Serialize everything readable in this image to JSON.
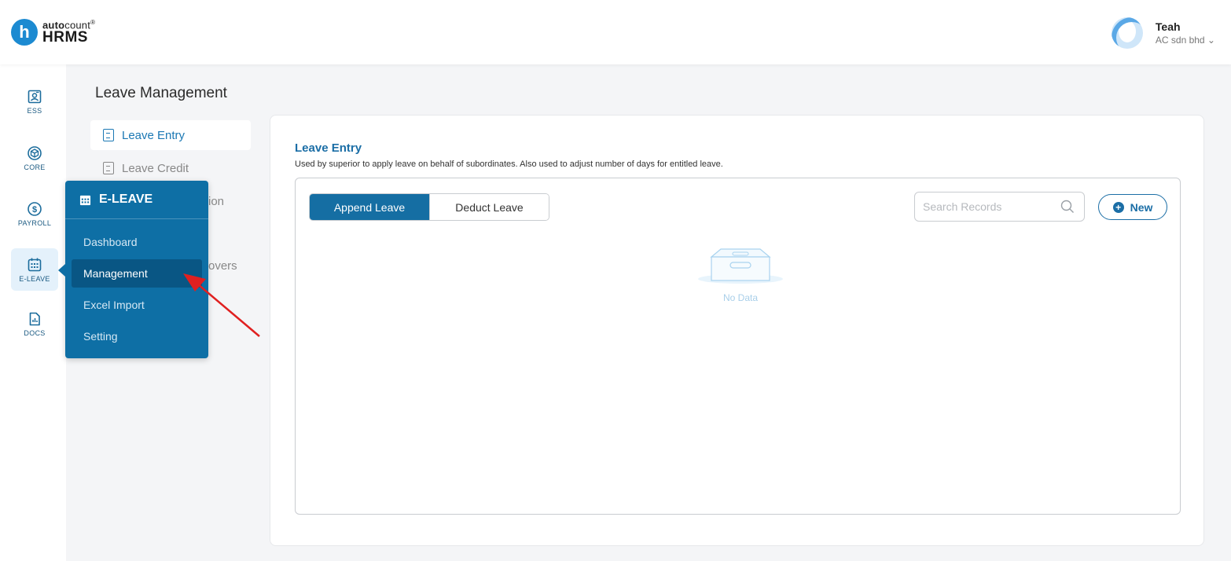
{
  "header": {
    "logo_letter": "h",
    "logo_brand_bold": "auto",
    "logo_brand_light": "count",
    "logo_mark": "®",
    "logo_product": "HRMS",
    "user_name": "Teah",
    "company": "AC sdn bhd ⌄"
  },
  "rail": {
    "items": [
      {
        "label": "ESS",
        "icon": "ess-icon"
      },
      {
        "label": "CORE",
        "icon": "cube-icon"
      },
      {
        "label": "PAYROLL",
        "icon": "dollar-icon"
      },
      {
        "label": "E-LEAVE",
        "icon": "calendar-icon"
      },
      {
        "label": "DOCS",
        "icon": "document-chart-icon"
      }
    ],
    "active": "E-LEAVE"
  },
  "page": {
    "title": "Leave Management",
    "subnav": [
      {
        "label": "Leave Entry",
        "active": true
      },
      {
        "label": "Leave Credit",
        "active": false
      },
      {
        "label": "ion",
        "active": false
      },
      {
        "label": "overs",
        "active": false
      }
    ]
  },
  "card": {
    "title": "Leave Entry",
    "description": "Used by superior to apply leave on behalf of subordinates. Also used to adjust number of days for entitled leave.",
    "tabs": [
      "Append Leave",
      "Deduct Leave"
    ],
    "active_tab": "Append Leave",
    "search_placeholder": "Search Records",
    "new_button": "New",
    "empty_text": "No Data"
  },
  "flyout": {
    "title": "E-LEAVE",
    "items": [
      "Dashboard",
      "Management",
      "Excel Import",
      "Setting"
    ],
    "active": "Management"
  },
  "colors": {
    "primary": "#156ea3",
    "flyout_bg": "#0e6fa5",
    "flyout_active": "#095684",
    "annotation_arrow": "#e02020"
  }
}
